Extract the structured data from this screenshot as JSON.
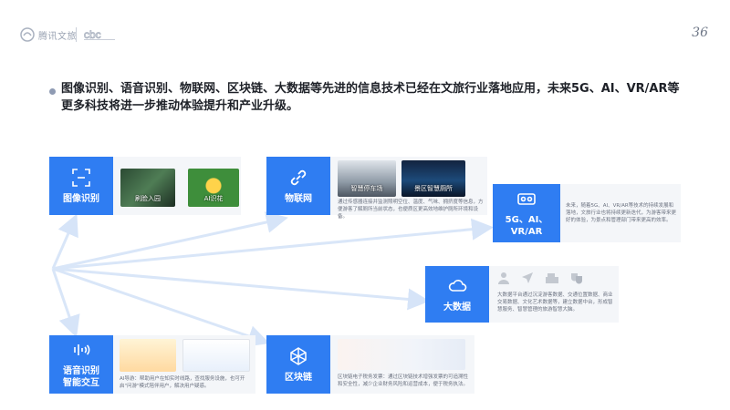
{
  "header": {
    "logo_text": "腾讯文旅",
    "page_number": "36"
  },
  "main_text": "图像识别、语音识别、物联网、区块链、大数据等先进的信息技术已经在文旅行业落地应用，未来5G、AI、VR/AR等更多科技将进一步推动体验提升和产业升级。",
  "cards": {
    "image_recognition": {
      "label": "图像识别",
      "thumb1_caption": "刷脸入园",
      "thumb2_caption": "AI识花"
    },
    "iot": {
      "label": "物联网",
      "desc": "通过传感器连接并监测照明空位、温度、气味、拥挤度等信息，方便游客了解厕所当前状态，也便质区更高效地维护厕所环境和设备。",
      "thumb1_caption": "智慧停车场",
      "thumb2_caption": "景区智慧厕所"
    },
    "future": {
      "label": "5G、AI、VR/AR",
      "desc": "未来，随着5G、AI、VR/AR等技术的持续发展和落地，文旅行业也将持续更新迭代，为游客带来更好的体验，为景点和管理部门带来更高的效率。"
    },
    "bigdata": {
      "label": "大数据",
      "desc": "大数据平台通过沉淀游客数据、交通位置数据、商业交易数据、文化艺术数据等，建立数据中台，形成智慧服务、智慧管理的旅游智慧大脑。"
    },
    "voice": {
      "label": "语音识别\n智能交互",
      "desc": "AI导游：帮助用户在知实时线路，查找服务设施，也可开启\"问游\"模式陪伴用户，解决用户疑惑。"
    },
    "blockchain": {
      "label": "区块链",
      "desc": "区块链电子税务发票：通过区块链技术增强发票的可追溯性和安全性，减少企业财务风险和运营成本，便于税务执法。"
    }
  },
  "colors": {
    "tile_blue": "#2f7df2",
    "card_bg": "#f4f6f9",
    "arrow": "#d6e4f8"
  }
}
